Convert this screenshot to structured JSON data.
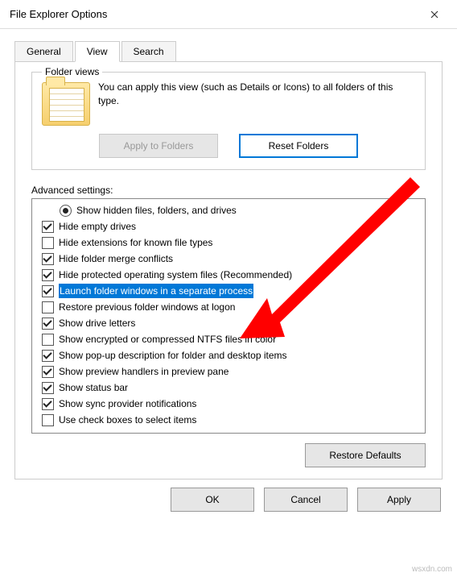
{
  "window": {
    "title": "File Explorer Options"
  },
  "tabs": {
    "general": "General",
    "view": "View",
    "search": "Search"
  },
  "folderViews": {
    "legend": "Folder views",
    "desc": "You can apply this view (such as Details or Icons) to all folders of this type.",
    "applyBtn": "Apply to Folders",
    "resetBtn": "Reset Folders"
  },
  "advanced": {
    "label": "Advanced settings:",
    "items": [
      {
        "kind": "radio",
        "checked": true,
        "indent": 2,
        "label": "Show hidden files, folders, and drives"
      },
      {
        "kind": "check",
        "checked": true,
        "indent": 1,
        "label": "Hide empty drives"
      },
      {
        "kind": "check",
        "checked": false,
        "indent": 1,
        "label": "Hide extensions for known file types"
      },
      {
        "kind": "check",
        "checked": true,
        "indent": 1,
        "label": "Hide folder merge conflicts"
      },
      {
        "kind": "check",
        "checked": true,
        "indent": 1,
        "label": "Hide protected operating system files (Recommended)"
      },
      {
        "kind": "check",
        "checked": true,
        "indent": 1,
        "label": "Launch folder windows in a separate process",
        "selected": true
      },
      {
        "kind": "check",
        "checked": false,
        "indent": 1,
        "label": "Restore previous folder windows at logon"
      },
      {
        "kind": "check",
        "checked": true,
        "indent": 1,
        "label": "Show drive letters"
      },
      {
        "kind": "check",
        "checked": false,
        "indent": 1,
        "label": "Show encrypted or compressed NTFS files in color"
      },
      {
        "kind": "check",
        "checked": true,
        "indent": 1,
        "label": "Show pop-up description for folder and desktop items"
      },
      {
        "kind": "check",
        "checked": true,
        "indent": 1,
        "label": "Show preview handlers in preview pane"
      },
      {
        "kind": "check",
        "checked": true,
        "indent": 1,
        "label": "Show status bar"
      },
      {
        "kind": "check",
        "checked": true,
        "indent": 1,
        "label": "Show sync provider notifications"
      },
      {
        "kind": "check",
        "checked": false,
        "indent": 1,
        "label": "Use check boxes to select items"
      }
    ]
  },
  "restoreDefaults": "Restore Defaults",
  "dialog": {
    "ok": "OK",
    "cancel": "Cancel",
    "apply": "Apply"
  },
  "watermark": "wsxdn.com",
  "arrow": {
    "color": "#ff0000"
  }
}
